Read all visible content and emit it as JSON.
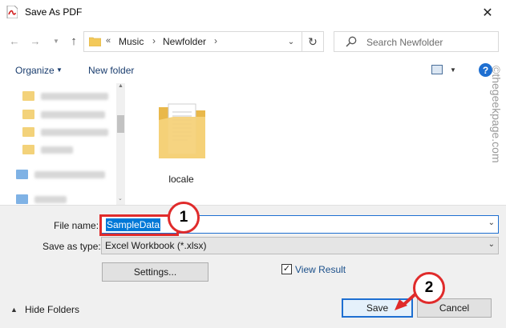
{
  "window": {
    "title": "Save As PDF"
  },
  "address": {
    "overflow": "«",
    "crumbs": [
      "Music",
      "Newfolder"
    ],
    "search_placeholder": "Search Newfolder"
  },
  "toolbar": {
    "organize": "Organize",
    "new_folder": "New folder"
  },
  "files": [
    {
      "name": "locale"
    }
  ],
  "form": {
    "file_name_label": "File name:",
    "file_name_value": "SampleData",
    "save_type_label": "Save as type:",
    "save_type_value": "Excel Workbook (*.xlsx)",
    "settings_label": "Settings...",
    "view_result_label": "View Result",
    "view_result_checked": true,
    "hide_folders_label": "Hide Folders",
    "save_label": "Save",
    "cancel_label": "Cancel"
  },
  "annotations": {
    "step1": "1",
    "step2": "2"
  },
  "watermark": "©thegeekpage.com",
  "colors": {
    "accent": "#1e6fd1",
    "highlight": "#e02b2b",
    "folder": "#f3c95a"
  }
}
